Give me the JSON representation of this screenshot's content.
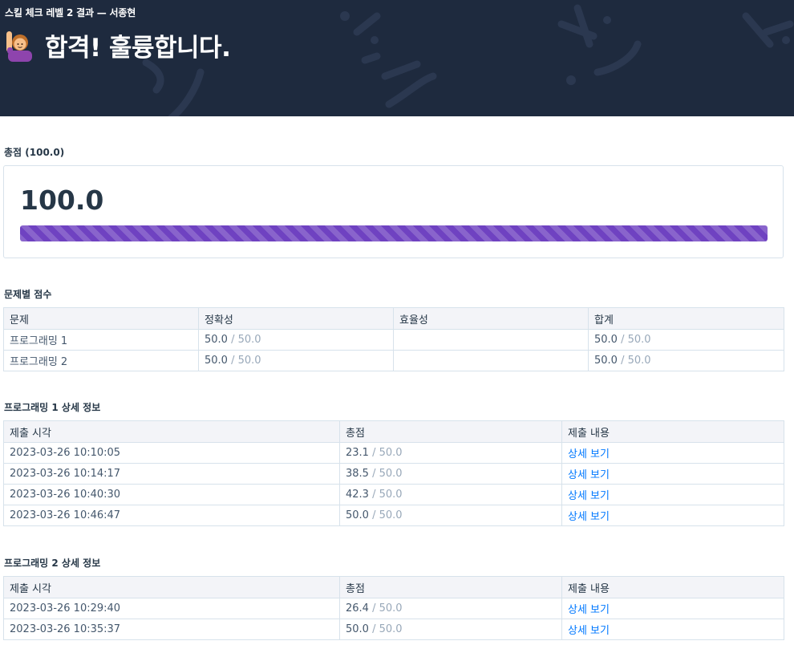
{
  "header": {
    "subtitle": "스킬 체크 레벨 2 결과 — 서종현",
    "title": "합격! 훌륭합니다.",
    "emoji_icon": "person-raising-hand-icon"
  },
  "total": {
    "section_title": "총점 (100.0)",
    "score": "100.0",
    "progress_fraction": 1.0,
    "bar_color": "#6f42c1"
  },
  "per_problem": {
    "section_title": "문제별 점수",
    "headers": [
      "문제",
      "정확성",
      "효율성",
      "합계"
    ],
    "rows": [
      {
        "problem": "프로그래밍 1",
        "accuracy": "50.0",
        "accuracy_max": "/ 50.0",
        "efficiency": "",
        "sum": "50.0",
        "sum_max": "/ 50.0"
      },
      {
        "problem": "프로그래밍 2",
        "accuracy": "50.0",
        "accuracy_max": "/ 50.0",
        "efficiency": "",
        "sum": "50.0",
        "sum_max": "/ 50.0"
      }
    ]
  },
  "detail1": {
    "section_title": "프로그래밍 1 상세 정보",
    "headers": [
      "제출 시각",
      "총점",
      "제출 내용"
    ],
    "rows": [
      {
        "time": "2023-03-26 10:10:05",
        "score": "23.1",
        "max": "/ 50.0",
        "link": "상세 보기"
      },
      {
        "time": "2023-03-26 10:14:17",
        "score": "38.5",
        "max": "/ 50.0",
        "link": "상세 보기"
      },
      {
        "time": "2023-03-26 10:40:30",
        "score": "42.3",
        "max": "/ 50.0",
        "link": "상세 보기"
      },
      {
        "time": "2023-03-26 10:46:47",
        "score": "50.0",
        "max": "/ 50.0",
        "link": "상세 보기"
      }
    ]
  },
  "detail2": {
    "section_title": "프로그래밍 2 상세 정보",
    "headers": [
      "제출 시각",
      "총점",
      "제출 내용"
    ],
    "rows": [
      {
        "time": "2023-03-26 10:29:40",
        "score": "26.4",
        "max": "/ 50.0",
        "link": "상세 보기"
      },
      {
        "time": "2023-03-26 10:35:37",
        "score": "50.0",
        "max": "/ 50.0",
        "link": "상세 보기"
      }
    ]
  },
  "colors": {
    "header_bg": "#1e2a3e",
    "link": "#0078ff",
    "muted": "#98a8b9"
  }
}
